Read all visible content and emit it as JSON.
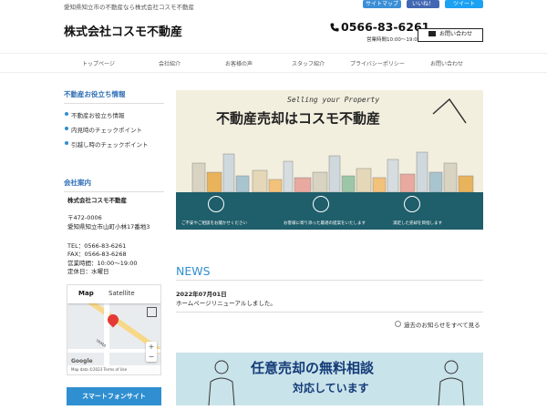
{
  "header": {
    "tagline": "愛知県知立市の不動産なら株式会社コスモ不動産",
    "site_title": "株式会社コスモ不動産",
    "phone": "0566-83-6261",
    "hours": "営業時間10:00～19:00",
    "contact_label": "お問い合わせ",
    "social": {
      "sitemap": "サイトマップ",
      "like": "いいね！",
      "tweet": "ツイート"
    }
  },
  "nav": {
    "items": [
      "トップページ",
      "会社紹介",
      "お客様の声",
      "スタッフ紹介",
      "プライバシーポリシー",
      "お問い合わせ"
    ]
  },
  "sidebar": {
    "useful_heading": "不動産お役立ち情報",
    "useful_links": [
      "不動産お役立ち情報",
      "内見時のチェックポイント",
      "引越し時のチェックポイント"
    ],
    "company_heading": "会社案内",
    "company": {
      "name": "株式会社コスモ不動産",
      "postal": "〒472-0006",
      "address": "愛知県知立市山町小林17番地3",
      "tel": "TEL：0566-83-6261",
      "fax": "FAX：0566-83-6268",
      "hours": "営業時間：10:00～19:00",
      "holiday": "定休日：水曜日"
    },
    "map": {
      "tab_map": "Map",
      "tab_satellite": "Satellite",
      "google": "Google",
      "footer": "Map data ©2023  Terms of Use",
      "road_label": "YAMA"
    },
    "smartphone_button": "スマートフォンサイト"
  },
  "hero": {
    "subtitle": "Selling your Property",
    "title": "不動産売却はコスモ不動産",
    "captions": [
      "ご不安やご相談をお聞かせください",
      "お客様に寄り添った最適の提案をいたします",
      "満足した売却を目指します"
    ],
    "colors": {
      "band": "#1f5e6b",
      "bg": "#f3efdf"
    }
  },
  "news": {
    "heading": "NEWS",
    "date": "2022年07月01日",
    "text": "ホームページリニューアルしました。",
    "all_link": "過去のお知らせをすべて見る"
  },
  "banner": {
    "title": "任意売却の無料相談",
    "subtitle": "対応しています"
  },
  "colors": {
    "accent": "#2f8fd0",
    "heading": "#2f6fb5",
    "banner_text": "#143b78"
  }
}
